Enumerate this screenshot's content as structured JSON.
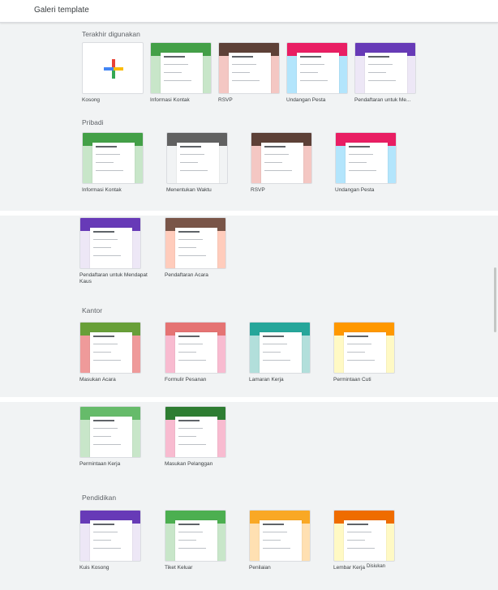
{
  "header": {
    "title": "Galeri template"
  },
  "sections": {
    "recent": "Terakhir digunakan",
    "personal": "Pribadi",
    "work": "Kantor",
    "education": "Pendidikan"
  },
  "templates": {
    "blank": "Kosong",
    "contact_info_recent": "Informasi Kontak",
    "rsvp_recent": "RSVP",
    "party_invite_recent": "Undangan Pesta",
    "tshirt_signup_recent": "Pendaftaran untuk Me...",
    "contact_info": "Informasi Kontak",
    "find_time": "Menentukan Waktu",
    "rsvp": "RSVP",
    "party_invite": "Undangan Pesta",
    "tshirt_signup": "Pendaftaran untuk Mendapat Kaus",
    "event_registration": "Pendaftaran Acara",
    "event_feedback": "Masukan Acara",
    "order_form": "Formulir Pesanan",
    "job_application": "Lamaran Kerja",
    "time_off": "Permintaan Cuti",
    "work_request": "Permintaan Kerja",
    "customer_feedback": "Masukan Pelanggan",
    "blank_quiz": "Kuis Kosong",
    "exit_ticket": "Tiket Keluar",
    "assessment": "Penilaian",
    "worksheet": "Lembar Kerja"
  },
  "tooltip": "Disiukan",
  "colors": {
    "green": "#43a047",
    "purple": "#673ab7",
    "orange": "#e46a35",
    "teal": "#00897b",
    "red": "#db4437",
    "blue": "#03a9f4"
  }
}
